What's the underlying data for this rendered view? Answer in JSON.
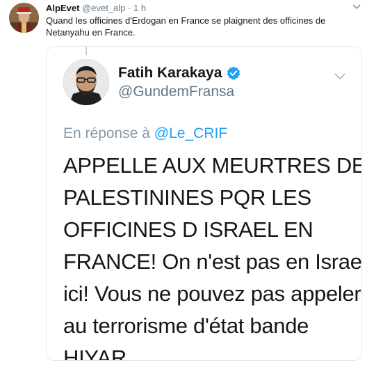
{
  "tweet": {
    "author_name": "AlpEvet",
    "handle": "@evet_alp",
    "separator": "·",
    "time": "1 h",
    "text": "Quand les officines d'Erdogan en France se plaignent des officines de Netanyahu en France."
  },
  "quoted": {
    "author_name": "Fatih Karakaya",
    "handle": "@GundemFransa",
    "reply_prefix": "En réponse à",
    "reply_to": "@Le_CRIF",
    "text_lines": [
      "APPELLE AUX MEURTRES DES",
      "PALESTININES PQR LES",
      "OFFICINES D ISRAEL EN",
      "FRANCE! On n'est pas en Israel",
      "ici! Vous ne pouvez pas appeler",
      "au terrorisme d'état bande",
      "HIYAR"
    ]
  },
  "colors": {
    "link": "#1da1f2",
    "verified": "#1da1f2",
    "muted": "#657786",
    "text": "#14171a"
  }
}
